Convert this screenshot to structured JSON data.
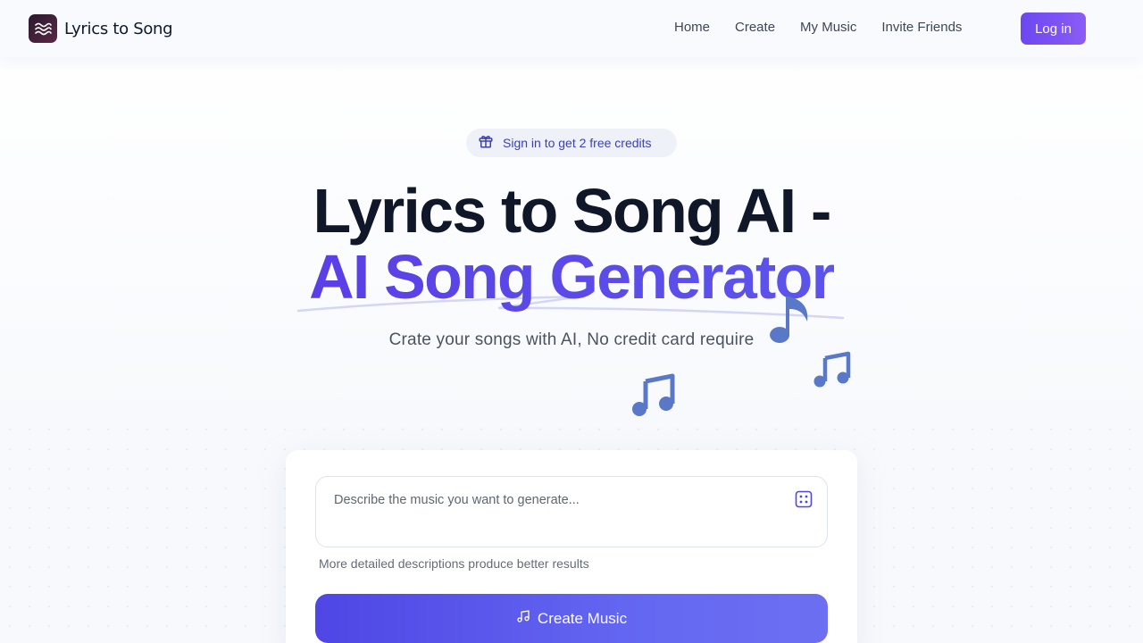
{
  "header": {
    "brand": "Lyrics to Song",
    "nav": [
      "Home",
      "Create",
      "My Music",
      "Invite Friends"
    ],
    "login": "Log in"
  },
  "hero": {
    "badge": "Sign in to get 2 free credits",
    "title_line1": "Lyrics to Song AI -",
    "title_line2": "AI Song Generator",
    "subtitle": "Crate your songs with AI, No credit card require"
  },
  "form": {
    "prompt_placeholder": "Describe the music you want to generate...",
    "prompt_value": "",
    "hint": "More detailed descriptions produce better results",
    "submit": "Create Music"
  },
  "icons": {
    "logo": "waves-icon",
    "badge": "gift-icon",
    "random": "dice-icon",
    "submit": "music-note-icon",
    "decor": [
      "eighth-note-icon",
      "beamed-notes-icon",
      "beamed-notes-icon"
    ]
  },
  "colors": {
    "accent": "#5b45e8",
    "button": "#4f46e5",
    "login_button": "#7c4ff2",
    "note": "#5a78c8"
  }
}
